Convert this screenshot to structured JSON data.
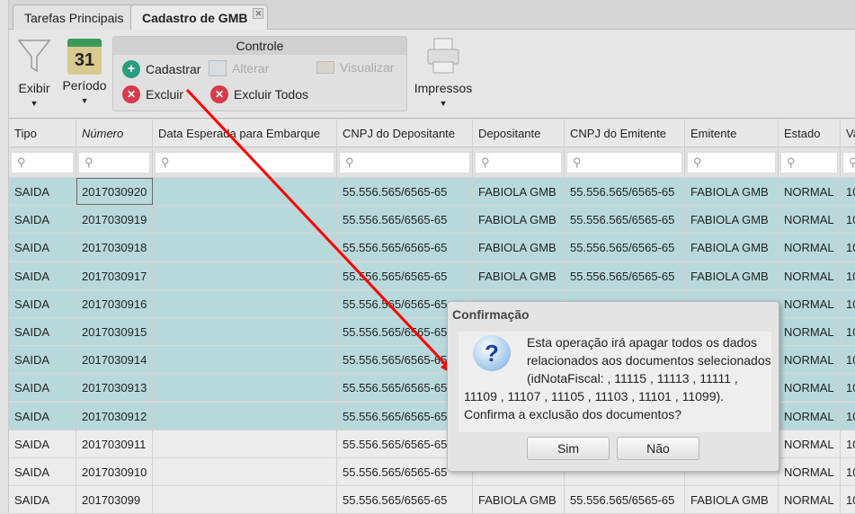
{
  "tabs": [
    {
      "label": "Tarefas Principais"
    },
    {
      "label": "Cadastro de GMB"
    }
  ],
  "toolbar": {
    "exibir": "Exibir",
    "periodo": "Período",
    "calendar_day": "31",
    "impressos": "Impressos",
    "group_title": "Controle",
    "cadastrar": "Cadastrar",
    "alterar": "Alterar",
    "visualizar": "Visualizar",
    "excluir": "Excluir",
    "excluir_todos": "Excluir Todos"
  },
  "columns": [
    "Tipo",
    "Número",
    "Data Esperada para Embarque",
    "CNPJ do Depositante",
    "Depositante",
    "CNPJ do Emitente",
    "Emitente",
    "Estado",
    "Va"
  ],
  "rows": [
    [
      "SAIDA",
      "2017030920",
      "",
      "55.556.565/6565-65",
      "FABIOLA GMB",
      "55.556.565/6565-65",
      "FABIOLA GMB",
      "NORMAL",
      "10"
    ],
    [
      "SAIDA",
      "2017030919",
      "",
      "55.556.565/6565-65",
      "FABIOLA GMB",
      "55.556.565/6565-65",
      "FABIOLA GMB",
      "NORMAL",
      "10"
    ],
    [
      "SAIDA",
      "2017030918",
      "",
      "55.556.565/6565-65",
      "FABIOLA GMB",
      "55.556.565/6565-65",
      "FABIOLA GMB",
      "NORMAL",
      "10"
    ],
    [
      "SAIDA",
      "2017030917",
      "",
      "55.556.565/6565-65",
      "FABIOLA GMB",
      "55.556.565/6565-65",
      "FABIOLA GMB",
      "NORMAL",
      "10"
    ],
    [
      "SAIDA",
      "2017030916",
      "",
      "55.556.565/6565-65",
      "",
      "",
      "",
      "NORMAL",
      "10"
    ],
    [
      "SAIDA",
      "2017030915",
      "",
      "55.556.565/6565-65",
      "",
      "",
      "",
      "NORMAL",
      "10"
    ],
    [
      "SAIDA",
      "2017030914",
      "",
      "55.556.565/6565-65",
      "",
      "",
      "",
      "NORMAL",
      "10"
    ],
    [
      "SAIDA",
      "2017030913",
      "",
      "55.556.565/6565-65",
      "",
      "",
      "",
      "NORMAL",
      "10"
    ],
    [
      "SAIDA",
      "2017030912",
      "",
      "55.556.565/6565-65",
      "",
      "",
      "",
      "NORMAL",
      "10"
    ],
    [
      "SAIDA",
      "2017030911",
      "",
      "55.556.565/6565-65",
      "",
      "",
      "",
      "NORMAL",
      "10"
    ],
    [
      "SAIDA",
      "2017030910",
      "",
      "55.556.565/6565-65",
      "",
      "",
      "",
      "NORMAL",
      "10"
    ],
    [
      "SAIDA",
      "201703099",
      "",
      "55.556.565/6565-65",
      "FABIOLA GMB",
      "55.556.565/6565-65",
      "FABIOLA GMB",
      "NORMAL",
      "10"
    ]
  ],
  "selected_count": 9,
  "dialog": {
    "title": "Confirmação",
    "message": "Esta operação irá apagar todos os dados relacionados aos documentos selecionados (idNotaFiscal: , 11115 , 11113 , 11111 , 11109 , 11107 , 11105 , 11103 , 11101 , 11099). Confirma a exclusão dos documentos?",
    "yes": "Sim",
    "no": "Não"
  },
  "colors": {
    "selected_row": "#b8d9dc",
    "arrow": "#ff0000"
  }
}
